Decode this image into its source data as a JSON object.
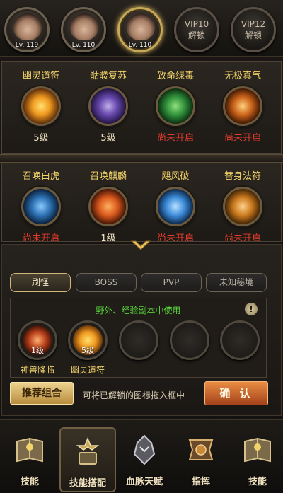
{
  "heroes": [
    {
      "level": "Lv. 119",
      "active": false
    },
    {
      "level": "Lv. 110",
      "active": false
    },
    {
      "level": "Lv. 110",
      "active": true
    }
  ],
  "locked_slots": [
    {
      "vip": "VIP10",
      "label": "解锁"
    },
    {
      "vip": "VIP12",
      "label": "解锁"
    }
  ],
  "skills_row1": [
    {
      "name": "幽灵道符",
      "state": "5级",
      "unlocked": true,
      "icon": "talisman-icon",
      "color": "#f0a020"
    },
    {
      "name": "骷髅复苏",
      "state": "5级",
      "unlocked": true,
      "icon": "skull-icon",
      "color": "#6a4ab0"
    },
    {
      "name": "致命绿毒",
      "state": "尚未开启",
      "unlocked": false,
      "icon": "poison-icon",
      "color": "#2f8f3a"
    },
    {
      "name": "无极真气",
      "state": "尚未开启",
      "unlocked": false,
      "icon": "qi-icon",
      "color": "#c86018"
    }
  ],
  "skills_row2": [
    {
      "name": "召唤白虎",
      "state": "尚未开启",
      "unlocked": false,
      "icon": "tiger-icon",
      "color": "#2b6fb0"
    },
    {
      "name": "召唤麒麟",
      "state": "1级",
      "unlocked": true,
      "icon": "qilin-icon",
      "color": "#d8581c"
    },
    {
      "name": "飓风破",
      "state": "尚未开启",
      "unlocked": false,
      "icon": "hurricane-icon",
      "color": "#3a8ad8"
    },
    {
      "name": "替身法符",
      "state": "尚未开启",
      "unlocked": false,
      "icon": "stand-in-icon",
      "color": "#c8781c"
    }
  ],
  "tabs": [
    {
      "label": "刷怪",
      "active": true
    },
    {
      "label": "BOSS",
      "active": false
    },
    {
      "label": "PVP",
      "active": false
    },
    {
      "label": "未知秘境",
      "active": false
    }
  ],
  "config": {
    "hint": "野外、经验副本中使用",
    "info_icon": "!",
    "slots": [
      {
        "name": "神兽降临",
        "level": "1级",
        "icon": "beast-icon",
        "color": "#b8401c"
      },
      {
        "name": "幽灵道符",
        "level": "5级",
        "icon": "talisman-icon",
        "color": "#f0a020"
      },
      {
        "name": "",
        "level": "",
        "icon": "",
        "color": ""
      },
      {
        "name": "",
        "level": "",
        "icon": "",
        "color": ""
      },
      {
        "name": "",
        "level": "",
        "icon": "",
        "color": ""
      }
    ],
    "recommend_label": "推荐组合",
    "drag_hint": "可将已解锁的图标拖入框中",
    "confirm_label": "确 认"
  },
  "nav": [
    {
      "label": "技能",
      "icon": "skill-book-icon",
      "active": false
    },
    {
      "label": "技能搭配",
      "icon": "skill-match-icon",
      "active": true
    },
    {
      "label": "血脉天赋",
      "icon": "bloodline-icon",
      "active": false
    },
    {
      "label": "指挥",
      "icon": "command-icon",
      "active": false
    },
    {
      "label": "技能",
      "icon": "skill-book-icon",
      "active": false
    }
  ]
}
